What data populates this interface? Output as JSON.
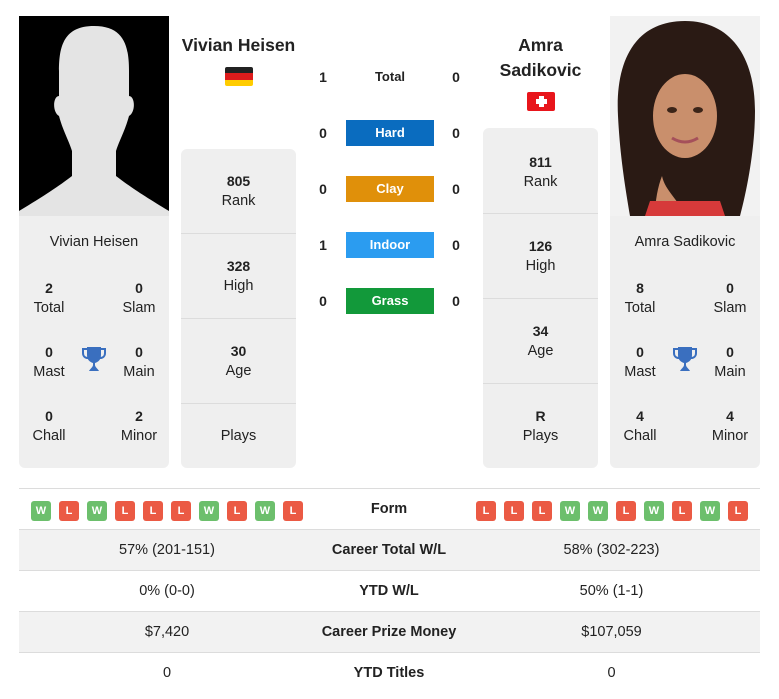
{
  "player_left": {
    "name": "Vivian Heisen",
    "country": "Germany",
    "flag_icon": "flag-germany-icon",
    "photo": "silhouette-placeholder",
    "card_name": "Vivian Heisen",
    "titles": {
      "total": {
        "value": "2",
        "label": "Total"
      },
      "slam": {
        "value": "0",
        "label": "Slam"
      },
      "mast": {
        "value": "0",
        "label": "Mast"
      },
      "main": {
        "value": "0",
        "label": "Main"
      },
      "chall": {
        "value": "0",
        "label": "Chall"
      },
      "minor": {
        "value": "2",
        "label": "Minor"
      }
    },
    "stats": {
      "rank": {
        "value": "805",
        "label": "Rank"
      },
      "high": {
        "value": "328",
        "label": "High"
      },
      "age": {
        "value": "30",
        "label": "Age"
      },
      "plays": {
        "value": "",
        "label": "Plays"
      }
    },
    "form": [
      "W",
      "L",
      "W",
      "L",
      "L",
      "L",
      "W",
      "L",
      "W",
      "L"
    ],
    "career_wl": "57% (201-151)",
    "ytd_wl": "0% (0-0)",
    "prize_money": "$7,420",
    "ytd_titles": "0"
  },
  "player_right": {
    "name": "Amra Sadikovic",
    "name_line1": "Amra",
    "name_line2": "Sadikovic",
    "country": "Switzerland",
    "flag_icon": "flag-switzerland-icon",
    "photo": "player-photo",
    "card_name": "Amra Sadikovic",
    "titles": {
      "total": {
        "value": "8",
        "label": "Total"
      },
      "slam": {
        "value": "0",
        "label": "Slam"
      },
      "mast": {
        "value": "0",
        "label": "Mast"
      },
      "main": {
        "value": "0",
        "label": "Main"
      },
      "chall": {
        "value": "4",
        "label": "Chall"
      },
      "minor": {
        "value": "4",
        "label": "Minor"
      }
    },
    "stats": {
      "rank": {
        "value": "811",
        "label": "Rank"
      },
      "high": {
        "value": "126",
        "label": "High"
      },
      "age": {
        "value": "34",
        "label": "Age"
      },
      "plays": {
        "value": "R",
        "label": "Plays"
      }
    },
    "form": [
      "L",
      "L",
      "L",
      "W",
      "W",
      "L",
      "W",
      "L",
      "W",
      "L"
    ],
    "career_wl": "58% (302-223)",
    "ytd_wl": "50% (1-1)",
    "prize_money": "$107,059",
    "ytd_titles": "0"
  },
  "h2h": {
    "total": {
      "label": "Total",
      "left": "1",
      "right": "0"
    },
    "surfaces": [
      {
        "label": "Hard",
        "left": "0",
        "right": "0",
        "color": "#0a6cbf"
      },
      {
        "label": "Clay",
        "left": "0",
        "right": "0",
        "color": "#e0900a"
      },
      {
        "label": "Indoor",
        "left": "1",
        "right": "0",
        "color": "#2b9cf0"
      },
      {
        "label": "Grass",
        "left": "0",
        "right": "0",
        "color": "#12993a"
      }
    ]
  },
  "table": {
    "form_label": "Form",
    "career_wl_label": "Career Total W/L",
    "ytd_wl_label": "YTD W/L",
    "prize_label": "Career Prize Money",
    "ytd_titles_label": "YTD Titles"
  }
}
